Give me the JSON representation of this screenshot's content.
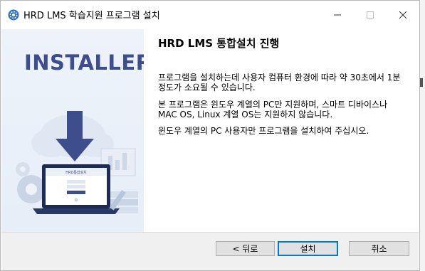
{
  "window": {
    "title": "HRD LMS 학습지원 프로그램 설치",
    "controls": {
      "minimize": "minimize-icon",
      "maximize": "maximize-icon",
      "close": "close-icon"
    }
  },
  "banner": {
    "title": "INSTALLER",
    "laptop_screen_title": "HRD통합설치"
  },
  "content": {
    "heading": "HRD LMS 통합설치 진행",
    "paragraphs": [
      "프로그램을 설치하는데 사용자 컴퓨터 환경에 따라 약 30초에서 1분 정도가 소요될 수 있습니다.",
      "본 프로그램은 윈도우 계열의 PC만 지원하며, 스마트 디바이스나 MAC OS, Linux 계열 OS는 지원하지 않습니다.",
      "윈도우 계열의 PC 사용자만 프로그램을 설치하여 주십시오."
    ]
  },
  "buttons": {
    "back": "< 뒤로",
    "install": "설치",
    "cancel": "취소"
  },
  "colors": {
    "accent": "#0078d7",
    "banner_title": "#3e4d8c",
    "arrow": "#3e4d8c"
  }
}
